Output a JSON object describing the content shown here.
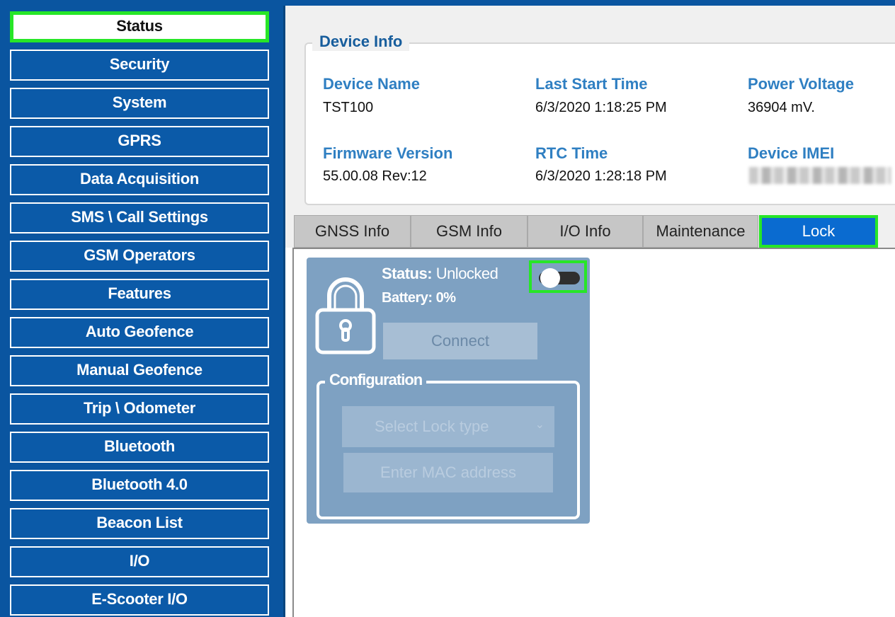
{
  "sidebar": {
    "items": [
      {
        "label": "Status",
        "active": true
      },
      {
        "label": "Security"
      },
      {
        "label": "System"
      },
      {
        "label": "GPRS"
      },
      {
        "label": "Data Acquisition"
      },
      {
        "label": "SMS \\ Call Settings"
      },
      {
        "label": "GSM Operators"
      },
      {
        "label": "Features"
      },
      {
        "label": "Auto Geofence"
      },
      {
        "label": "Manual Geofence"
      },
      {
        "label": "Trip \\ Odometer"
      },
      {
        "label": "Bluetooth"
      },
      {
        "label": "Bluetooth 4.0"
      },
      {
        "label": "Beacon List"
      },
      {
        "label": "I/O"
      },
      {
        "label": "E-Scooter I/O"
      }
    ]
  },
  "device_info": {
    "legend": "Device Info",
    "device_name_label": "Device Name",
    "device_name": "TST100",
    "last_start_label": "Last Start Time",
    "last_start": "6/3/2020 1:18:25 PM",
    "power_voltage_label": "Power Voltage",
    "power_voltage": "36904 mV.",
    "firmware_label": "Firmware Version",
    "firmware": "55.00.08 Rev:12",
    "rtc_label": "RTC Time",
    "rtc": "6/3/2020 1:28:18 PM",
    "imei_label": "Device IMEI"
  },
  "tabs": [
    {
      "label": "GNSS Info"
    },
    {
      "label": "GSM Info"
    },
    {
      "label": "I/O Info"
    },
    {
      "label": "Maintenance"
    },
    {
      "label": "Lock",
      "active": true
    }
  ],
  "lock": {
    "status_label": "Status:",
    "status_value": "Unlocked",
    "battery_label": "Battery:",
    "battery_value": "0%",
    "toggle_on": false,
    "connect_label": "Connect",
    "config_legend": "Configuration",
    "lock_type_placeholder": "Select Lock type",
    "mac_placeholder": "Enter MAC address"
  },
  "colors": {
    "sidebar_bg": "#0a55a0",
    "highlight": "#27e627",
    "active_tab": "#0a6bd0",
    "panel_bg": "#7ea1c2",
    "label_blue": "#2f7fc2"
  }
}
